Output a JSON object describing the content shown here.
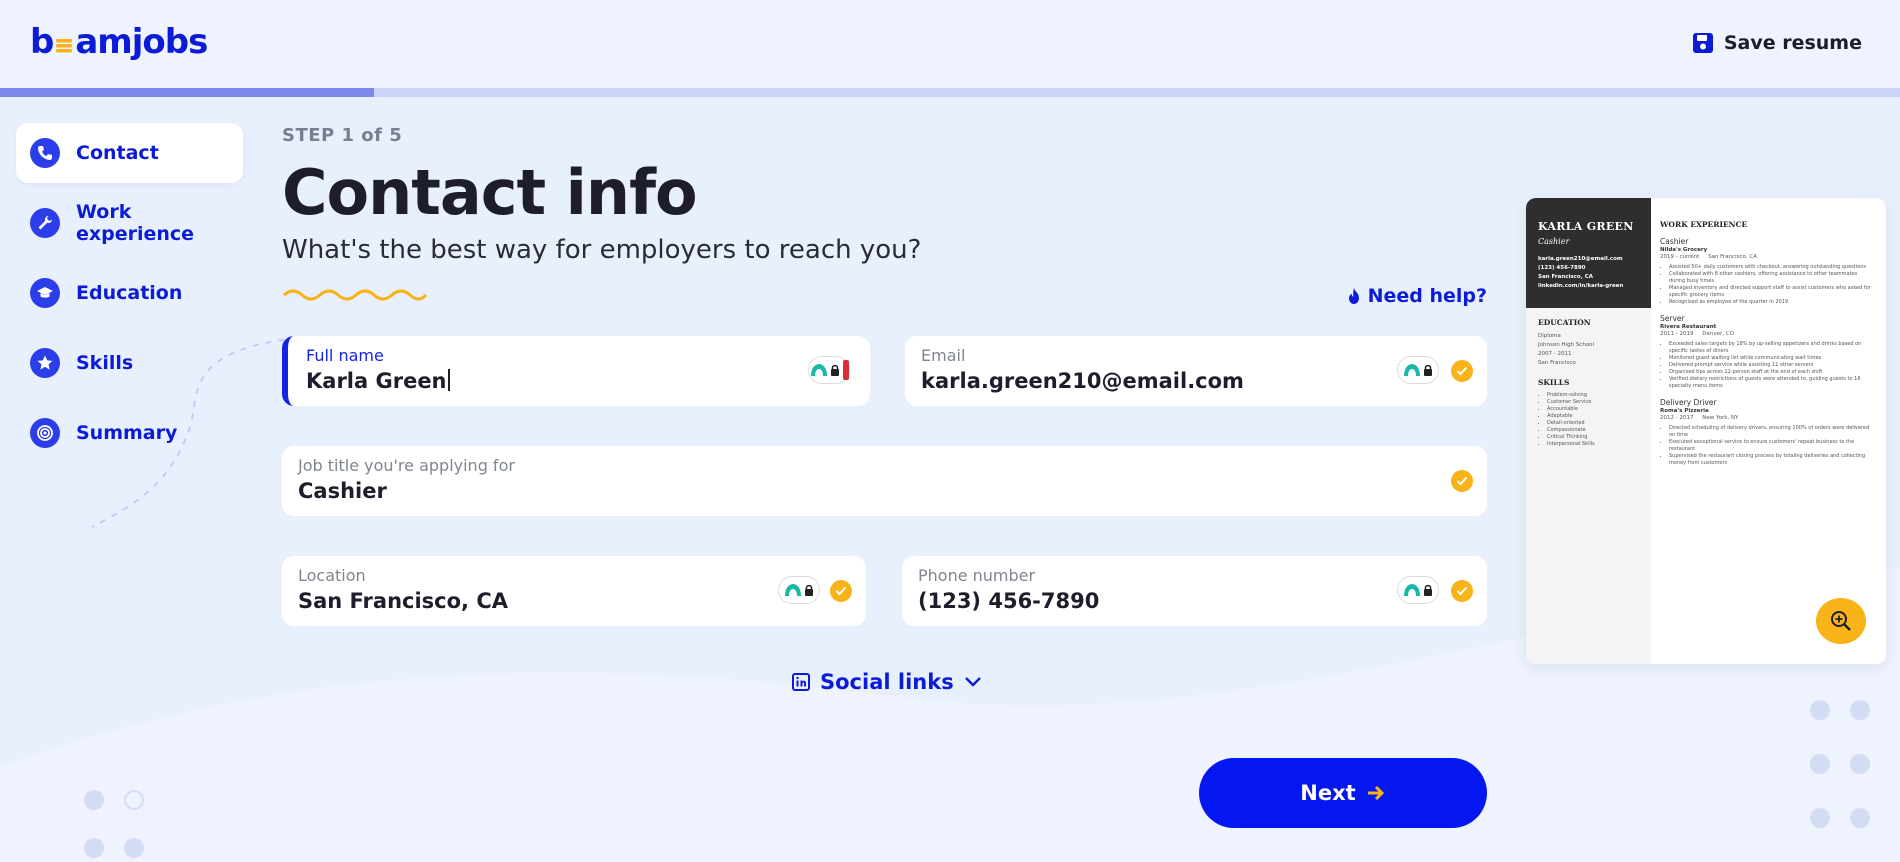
{
  "app": {
    "logo_text_pre": "b",
    "logo_text_post": "amjobs",
    "save_label": "Save resume",
    "progress_fraction": 0.197
  },
  "sidebar": {
    "items": [
      {
        "label": "Contact",
        "icon": "phone-icon",
        "active": true
      },
      {
        "label": "Work experience",
        "icon": "wrench-icon",
        "active": false
      },
      {
        "label": "Education",
        "icon": "graduation-cap-icon",
        "active": false
      },
      {
        "label": "Skills",
        "icon": "star-icon",
        "active": false
      },
      {
        "label": "Summary",
        "icon": "target-icon",
        "active": false
      }
    ]
  },
  "main": {
    "step": "STEP 1 of 5",
    "title": "Contact info",
    "subtitle": "What's the best way for employers to reach you?",
    "need_help": "Need help?"
  },
  "form": {
    "full_name": {
      "label": "Full name",
      "value": "Karla  Green"
    },
    "email": {
      "label": "Email",
      "value": "karla.green210@email.com"
    },
    "job_title": {
      "label": "Job title you're applying for",
      "value": "Cashier"
    },
    "location": {
      "label": "Location",
      "value": "San Francisco, CA"
    },
    "phone": {
      "label": "Phone number",
      "value": "(123) 456-7890"
    }
  },
  "social_links": "Social links",
  "next_label": "Next",
  "preview": {
    "name": "KARLA GREEN",
    "role": "Cashier",
    "contact": [
      "karla.green210@email.com",
      "(123) 456-7890",
      "San Francisco, CA",
      "linkedin.com/in/karla-green"
    ],
    "education_title": "EDUCATION",
    "education": [
      "Diploma",
      "Johnson High School",
      "2007 - 2011",
      "San Francisco"
    ],
    "skills_title": "SKILLS",
    "skills": [
      "Problem-solving",
      "Customer Service",
      "Accountable",
      "Adaptable",
      "Detail-oriented",
      "Compassionate",
      "Critical Thinking",
      "Interpersonal Skills"
    ],
    "work_title": "WORK EXPERIENCE",
    "jobs": [
      {
        "title": "Cashier",
        "company": "Nilda's Grocery",
        "dates": "2019 - current",
        "place": "San Francisco, CA",
        "bullets": [
          "Assisted 50+ daily customers with checkout, answering outstanding questions",
          "Collaborated with 8 other cashiers, offering assistance to other teammates during busy times",
          "Managed inventory and directed support staff to assist customers who asked for specific grocery items",
          "Recognized as employee of the quarter in 2019"
        ]
      },
      {
        "title": "Server",
        "company": "Rivera Restaurant",
        "dates": "2011 - 2019",
        "place": "Denver, CO",
        "bullets": [
          "Exceeded sales targets by 18% by up-selling appetizers and drinks based on specific tastes of diners",
          "Monitored guest waiting list while communicating wait times",
          "Delivered prompt service while assisting 11 other servers",
          "Organized tips across 12-person staff at the end of each shift",
          "Verified dietary restrictions of guests were attended to, guiding guests to 16 specialty menu items"
        ]
      },
      {
        "title": "Delivery Driver",
        "company": "Roma's Pizzeria",
        "dates": "2012 - 2017",
        "place": "New York, NY",
        "bullets": [
          "Directed scheduling of delivery drivers, ensuring 100% of orders were delivered on time",
          "Executed exceptional service to ensure customers' repeat business to the restaurant",
          "Supervised the restaurant closing process by totaling deliveries and collecting money from customers"
        ]
      }
    ]
  },
  "colors": {
    "brand_blue": "#0c1bd6",
    "accent_yellow": "#f7b318",
    "background": "#e9f0fd"
  }
}
